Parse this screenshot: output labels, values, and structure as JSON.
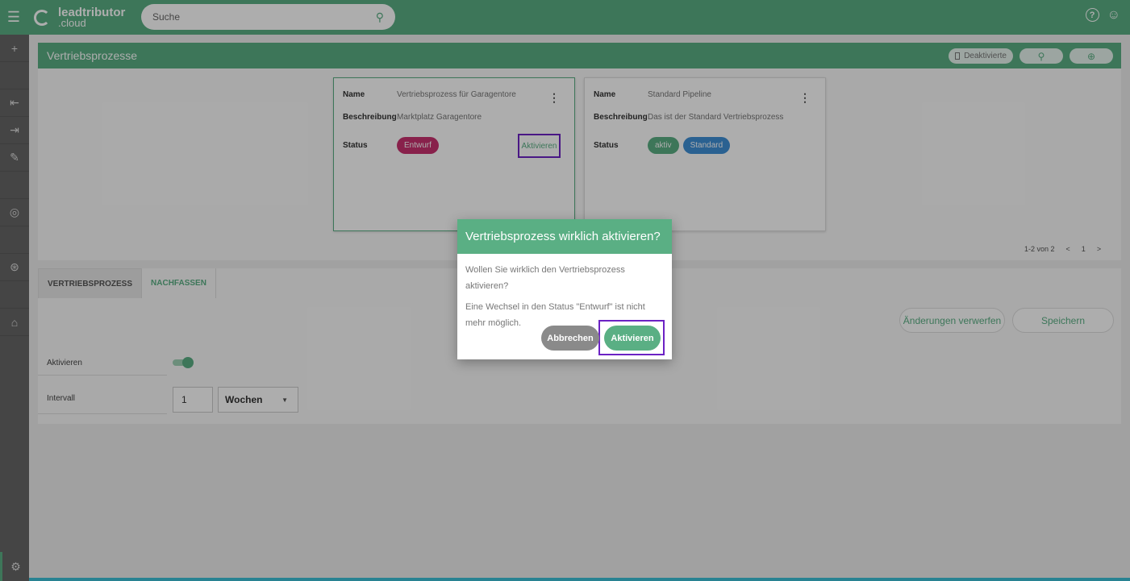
{
  "app": {
    "brand_line1": "leadtributor",
    "brand_line2": ".cloud"
  },
  "search": {
    "placeholder": "Suche"
  },
  "panel": {
    "title": "Vertriebsprozesse",
    "deactivated_label": "Deaktivierte"
  },
  "cards": [
    {
      "name_label": "Name",
      "name": "Vertriebsprozess für Garagentore",
      "desc_label": "Beschreibung",
      "description": "Marktplatz Garagentore",
      "status_label": "Status",
      "badges": [
        "Entwurf"
      ],
      "action": "Aktivieren"
    },
    {
      "name_label": "Name",
      "name": "Standard Pipeline",
      "desc_label": "Beschreibung",
      "description": "Das ist der Standard Vertriebsprozess",
      "status_label": "Status",
      "badges": [
        "aktiv",
        "Standard"
      ]
    }
  ],
  "pager": {
    "range": "1-2 von 2",
    "page": "1"
  },
  "tabs": [
    "VERTRIEBSPROZESS",
    "NACHFASSEN"
  ],
  "actions": {
    "discard": "Änderungen verwerfen",
    "save": "Speichern"
  },
  "form": {
    "activate_label": "Aktivieren",
    "activate_value": true,
    "interval_label": "Intervall",
    "interval_value": "1",
    "interval_unit": "Wochen"
  },
  "dialog": {
    "title": "Vertriebsprozess wirklich aktivieren?",
    "text1": "Wollen Sie wirklich den Vertriebsprozess aktivieren?",
    "text2": "Eine Wechsel in den Status \"Entwurf\" ist nicht mehr möglich.",
    "cancel": "Abbrechen",
    "confirm": "Aktivieren"
  },
  "colors": {
    "primary": "#5aaf84",
    "draft": "#c9326f",
    "standard": "#3f8fd6",
    "highlight": "#6c22c4"
  }
}
